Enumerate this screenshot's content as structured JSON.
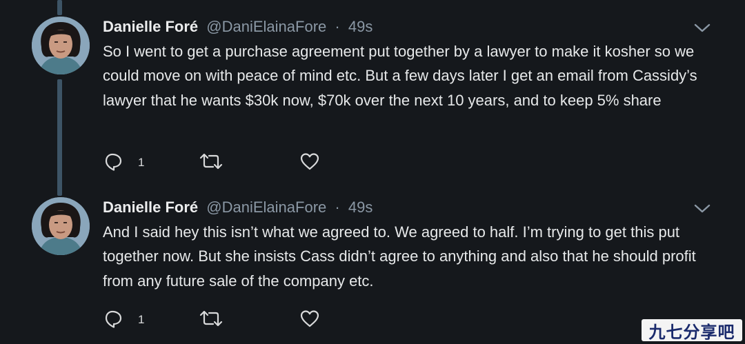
{
  "tweets": [
    {
      "display_name": "Danielle Foré",
      "handle": "@DaniElainaFore",
      "separator": "·",
      "time": "49s",
      "text": "So I went to get a purchase agreement put together by a lawyer to make it kosher so we could move on with peace of mind etc. But a few days later I get an email from Cassidy’s lawyer that he wants $30k now, $70k over the next 10 years, and to keep 5% share",
      "reply_count": "1"
    },
    {
      "display_name": "Danielle Foré",
      "handle": "@DaniElainaFore",
      "separator": "·",
      "time": "49s",
      "text": "And I said hey this isn’t what we agreed to. We agreed to half. I’m trying to get this put together now. But she insists Cass didn’t agree to anything and also that he should profit from any future sale of the company etc.",
      "reply_count": "1"
    }
  ],
  "watermark": {
    "text": "九七分享吧"
  },
  "icons": {
    "reply": "reply-bubble-icon",
    "retweet": "retweet-icon",
    "like": "heart-icon",
    "menu": "chevron-down-icon"
  },
  "colors": {
    "background": "#15181c",
    "text": "#e7e9ea",
    "secondary_text": "#8b98a5",
    "thread_line": "#3d5466"
  }
}
